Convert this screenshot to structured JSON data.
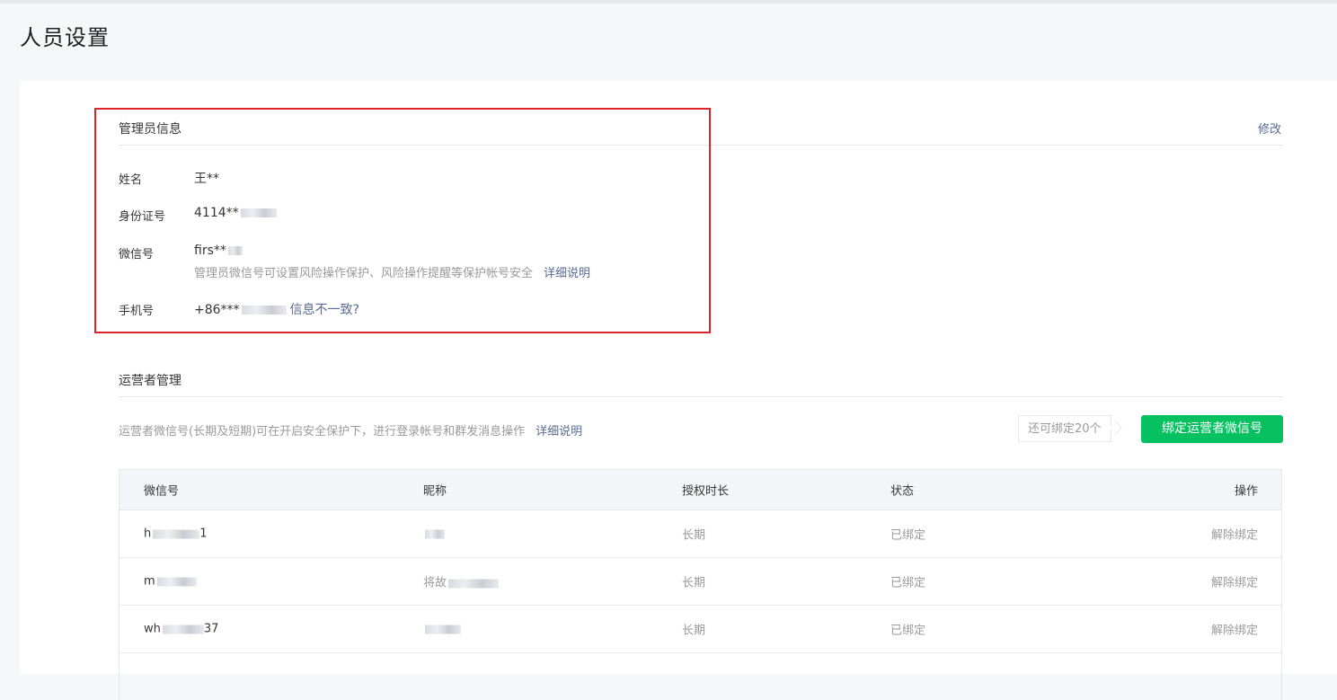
{
  "page": {
    "title": "人员设置"
  },
  "admin": {
    "section_title": "管理员信息",
    "edit_label": "修改",
    "name_label": "姓名",
    "name_value": "王**",
    "id_label": "身份证号",
    "id_value": "4114**",
    "wechat_label": "微信号",
    "wechat_value": "firs**",
    "wechat_tip": "管理员微信号可设置风险操作保护、风险操作提醒等保护帐号安全",
    "wechat_tip_link": "详细说明",
    "phone_label": "手机号",
    "phone_value": "+86***",
    "phone_link": "信息不一致?"
  },
  "operators": {
    "section_title": "运营者管理",
    "desc": "运营者微信号(长期及短期)可在开启安全保护下，进行登录帐号和群发消息操作",
    "desc_link": "详细说明",
    "quota": "还可绑定20个",
    "bind_button": "绑定运营者微信号",
    "columns": [
      "微信号",
      "昵称",
      "授权时长",
      "状态",
      "操作"
    ],
    "rows": [
      {
        "wechat": "h",
        "wechat_tail": "1",
        "nick": "",
        "duration": "长期",
        "status": "已绑定",
        "action": "解除绑定"
      },
      {
        "wechat": "m",
        "wechat_tail": "",
        "nick": "将故",
        "duration": "长期",
        "status": "已绑定",
        "action": "解除绑定"
      },
      {
        "wechat": "wh",
        "wechat_tail": "37",
        "nick": "",
        "duration": "长期",
        "status": "已绑定",
        "action": "解除绑定"
      }
    ]
  },
  "colors": {
    "accent": "#07c160",
    "link": "#576b95",
    "highlight_border": "#d9252b"
  }
}
